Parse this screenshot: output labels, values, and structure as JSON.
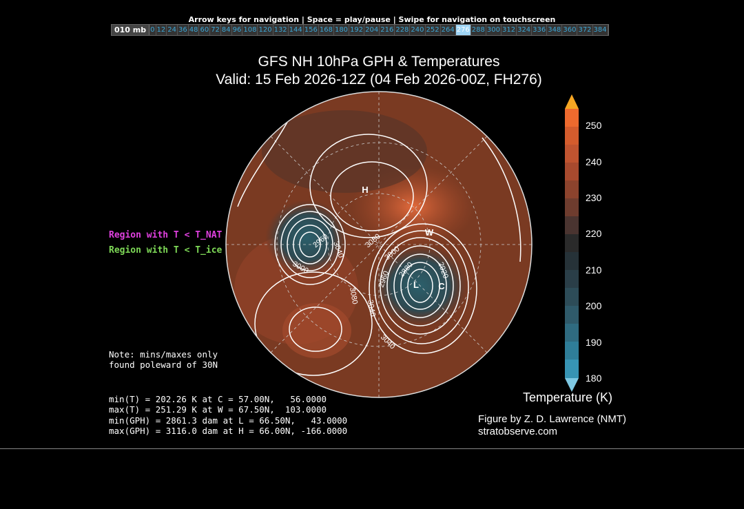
{
  "header": {
    "nav_hint": "Arrow keys for navigation | Space = play/pause | Swipe for navigation on touchscreen",
    "level": "010 mb",
    "forecast_hours": [
      "0",
      "12",
      "24",
      "36",
      "48",
      "60",
      "72",
      "84",
      "96",
      "108",
      "120",
      "132",
      "144",
      "156",
      "168",
      "180",
      "192",
      "204",
      "216",
      "228",
      "240",
      "252",
      "264",
      "276",
      "288",
      "300",
      "312",
      "324",
      "336",
      "348",
      "360",
      "372",
      "384"
    ],
    "active_hour": "276"
  },
  "figure": {
    "title_line1": "GFS NH 10hPa GPH & Temperatures",
    "title_line2": "Valid: 15 Feb 2026-12Z  (04 Feb 2026-00Z, FH276)",
    "legend_nat": "Region with T < T_NAT",
    "legend_ice": "Region with T < T_ice",
    "note": "Note: mins/maxes only\nfound poleward of 30N",
    "stats": [
      "min(T) = 202.26 K at C = 57.00N,   56.0000",
      "max(T) = 251.29 K at W = 67.50N,  103.0000",
      "min(GPH) = 2861.3 dam at L = 66.50N,   43.0000",
      "max(GPH) = 3116.0 dam at H = 66.00N, -166.0000"
    ],
    "markers": {
      "H": "H",
      "L": "L",
      "W": "W",
      "C": "C"
    },
    "contour_labels": [
      "2960",
      "3040",
      "3000",
      "3080",
      "3000",
      "2880",
      "2920",
      "2960",
      "3080",
      "3040",
      "3040"
    ],
    "colorbar": {
      "title": "Temperature (K)",
      "ticks": [
        "250",
        "240",
        "230",
        "220",
        "210",
        "200",
        "190",
        "180"
      ],
      "min": 180,
      "max": 255
    },
    "credit_line1": "Figure by Z. D. Lawrence (NMT)",
    "credit_line2": "stratobserve.com"
  }
}
